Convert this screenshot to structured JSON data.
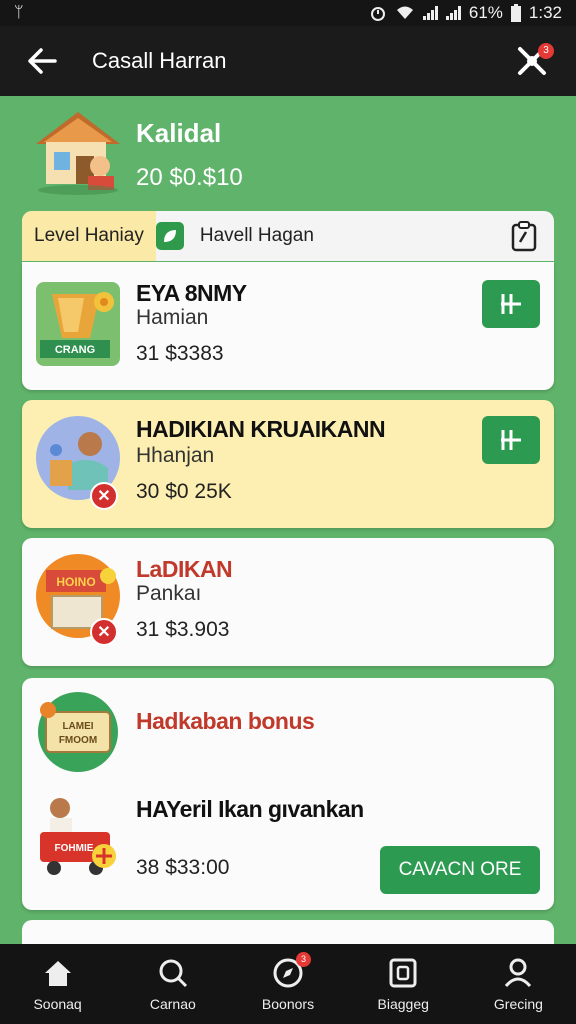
{
  "status_bar": {
    "left_icon": "usb-icon",
    "battery": "61%",
    "time": "1:32"
  },
  "header": {
    "title": "Casall Harran",
    "cart_badge": "3"
  },
  "hero": {
    "title": "Kalidal",
    "subtitle": "20  $0.$10"
  },
  "level_bar": {
    "tab_label": "Level Haniay",
    "name": "Havell Hagan"
  },
  "cards": [
    {
      "title": "EYA 8NMY",
      "sub": "Hamian",
      "price": "31  $3383",
      "icon_text": "CRANG"
    },
    {
      "title": "HADIKIAN KRUAIKANN",
      "sub": "Hhanjan",
      "price": "30  $0 25K"
    },
    {
      "title": "LaDIKAN",
      "sub": "Pankaı",
      "price": "31  $3.903",
      "icon_text": "HOINO"
    },
    {
      "title": "Hadkaban bonus",
      "title2": "HAYeril  Ikan gıvankan",
      "price": "38  $33:00",
      "button": "CAVACN ORE",
      "sign_text_1": "LAMEI",
      "sign_text_2": "FMOOM",
      "cart_text": "FOHMIE"
    }
  ],
  "bottom_nav": [
    {
      "label": "Soonaq",
      "icon": "home-icon"
    },
    {
      "label": "Carnao",
      "icon": "search-icon"
    },
    {
      "label": "Boonors",
      "icon": "compass-icon",
      "badge": "3"
    },
    {
      "label": "Biaggeg",
      "icon": "bag-icon"
    },
    {
      "label": "Grecing",
      "icon": "person-icon"
    }
  ],
  "colors": {
    "background": "#5fb36a",
    "header": "#1b1b1b",
    "accent_green": "#2d9a52",
    "highlight_yellow": "#fcefb1",
    "badge_red": "#e53935"
  }
}
